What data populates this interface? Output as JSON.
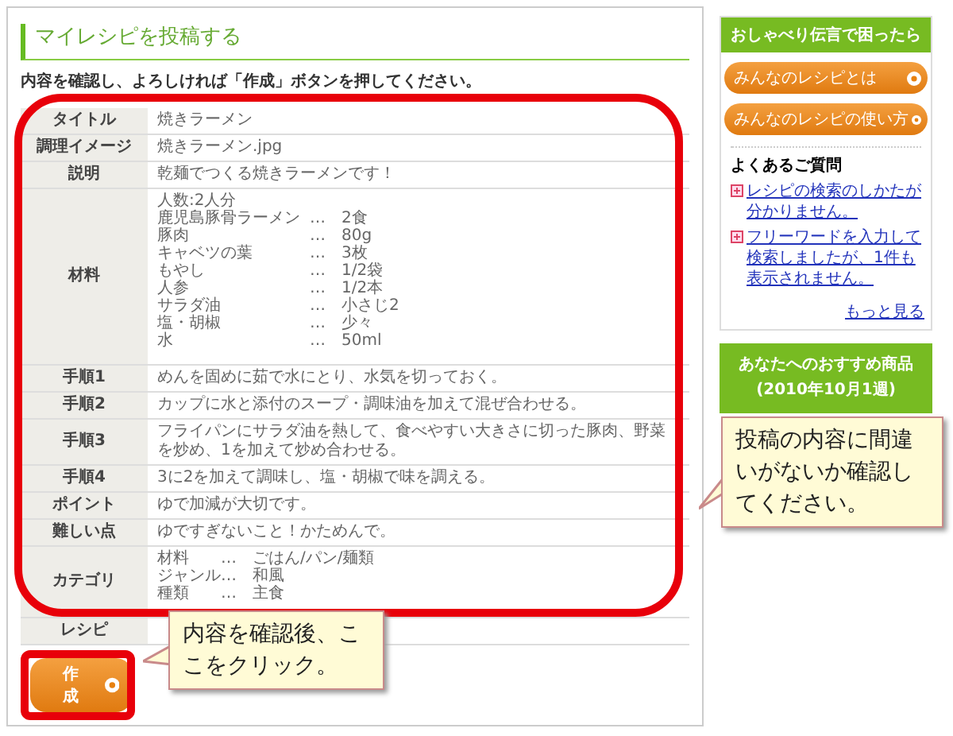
{
  "page_title": "マイレシピを投稿する",
  "instruction": "内容を確認し、よろしければ「作成」ボタンを押してください。",
  "table": {
    "rows": [
      {
        "label": "タイトル",
        "kind": "text",
        "value": "焼きラーメン"
      },
      {
        "label": "調理イメージ",
        "kind": "text",
        "value": "焼きラーメン.jpg"
      },
      {
        "label": "説明",
        "kind": "text",
        "value": "乾麺でつくる焼きラーメンです！"
      },
      {
        "label": "材料",
        "kind": "pairs",
        "header": "人数:2人分",
        "items": [
          {
            "name": "鹿児島豚骨ラーメン",
            "sep": "…",
            "amount": "2食"
          },
          {
            "name": "豚肉",
            "sep": "…",
            "amount": "80g"
          },
          {
            "name": "キャベツの葉",
            "sep": "…",
            "amount": "3枚"
          },
          {
            "name": "もやし",
            "sep": "…",
            "amount": "1/2袋"
          },
          {
            "name": "人参",
            "sep": "…",
            "amount": "1/2本"
          },
          {
            "name": "サラダ油",
            "sep": "…",
            "amount": "小さじ2"
          },
          {
            "name": "塩・胡椒",
            "sep": "…",
            "amount": "少々"
          },
          {
            "name": "水",
            "sep": "…",
            "amount": "50ml"
          }
        ]
      },
      {
        "label": "手順1",
        "kind": "text",
        "value": "めんを固めに茹で水にとり、水気を切っておく。"
      },
      {
        "label": "手順2",
        "kind": "text",
        "value": "カップに水と添付のスープ・調味油を加えて混ぜ合わせる。"
      },
      {
        "label": "手順3",
        "kind": "text",
        "value": "フライパンにサラダ油を熱して、食べやすい大きさに切った豚肉、野菜を炒め、1を加えて炒め合わせる。"
      },
      {
        "label": "手順4",
        "kind": "text",
        "value": "3に2を加えて調味し、塩・胡椒で味を調える。"
      },
      {
        "label": "ポイント",
        "kind": "text",
        "value": "ゆで加減が大切です。"
      },
      {
        "label": "難しい点",
        "kind": "text",
        "value": "ゆですぎないこと！かためんで。"
      },
      {
        "label": "カテゴリ",
        "kind": "pairs",
        "items": [
          {
            "name": "材料",
            "sep": "…",
            "amount": "ごはん/パン/麺類"
          },
          {
            "name": "ジャンル",
            "sep": "…",
            "amount": "和風"
          },
          {
            "name": "種類",
            "sep": "…",
            "amount": "主食"
          }
        ]
      },
      {
        "label": "レシピ",
        "kind": "text",
        "value": ""
      }
    ]
  },
  "create_button": "作成",
  "sidebar": {
    "header": "おしゃべり伝言で困ったら",
    "buttons": [
      "みんなのレシピとは",
      "みんなのレシピの使い方"
    ],
    "faq_title": "よくあるご質問",
    "faq_links": [
      "レシピの検索のしかたが分かりません。",
      "フリーワードを入力して検索しましたが、1件も表示されません。"
    ],
    "more": "もっと見る",
    "recommend": "あなたへのおすすめ商品(2010年10月1週)"
  },
  "callouts": [
    {
      "kind": "right",
      "text": "投稿の内容に間違いがないか確認してください。"
    },
    {
      "kind": "button",
      "text": "内容を確認後、ここをクリック。"
    }
  ]
}
